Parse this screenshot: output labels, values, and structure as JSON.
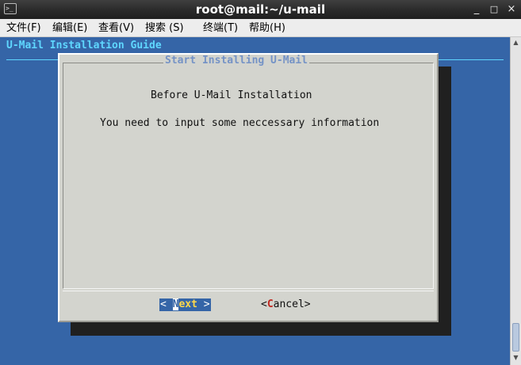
{
  "window": {
    "title": "root@mail:~/u-mail",
    "minimize_glyph": "_",
    "maximize_glyph": "□",
    "close_glyph": "×"
  },
  "menubar": {
    "items": [
      {
        "label": "文件(F)",
        "hotkey": "F"
      },
      {
        "label": "编辑(E)",
        "hotkey": "E"
      },
      {
        "label": "查看(V)",
        "hotkey": "V"
      },
      {
        "label": "搜索 (S)",
        "hotkey": "S"
      },
      {
        "label": "终端(T)",
        "hotkey": "T"
      },
      {
        "label": "帮助(H)",
        "hotkey": "H"
      }
    ]
  },
  "terminal": {
    "background_color": "#3565a7",
    "guide_title": "U-Mail Installation Guide"
  },
  "dialog": {
    "title": "Start Installing U-Mail",
    "lines": [
      "Before U-Mail Installation",
      "You need to input some neccessary information"
    ],
    "buttons": {
      "next": {
        "prefix": "< ",
        "hot": "N",
        "rest": "ext",
        "suffix": " >",
        "selected": true
      },
      "cancel": {
        "prefix": "<",
        "hot": "C",
        "rest": "ancel",
        "suffix": ">",
        "selected": false
      }
    }
  },
  "colors": {
    "accent_cyan": "#5fd7ff",
    "dialog_bg": "#d3d4ce",
    "dialog_title": "#7593c6",
    "hotkey_red": "#c0271f",
    "selected_text_yellow": "#ffd84a"
  },
  "icons": {
    "app_icon": "terminal-icon",
    "scroll_up": "scroll-up-arrow-icon",
    "scroll_down": "scroll-down-arrow-icon"
  }
}
